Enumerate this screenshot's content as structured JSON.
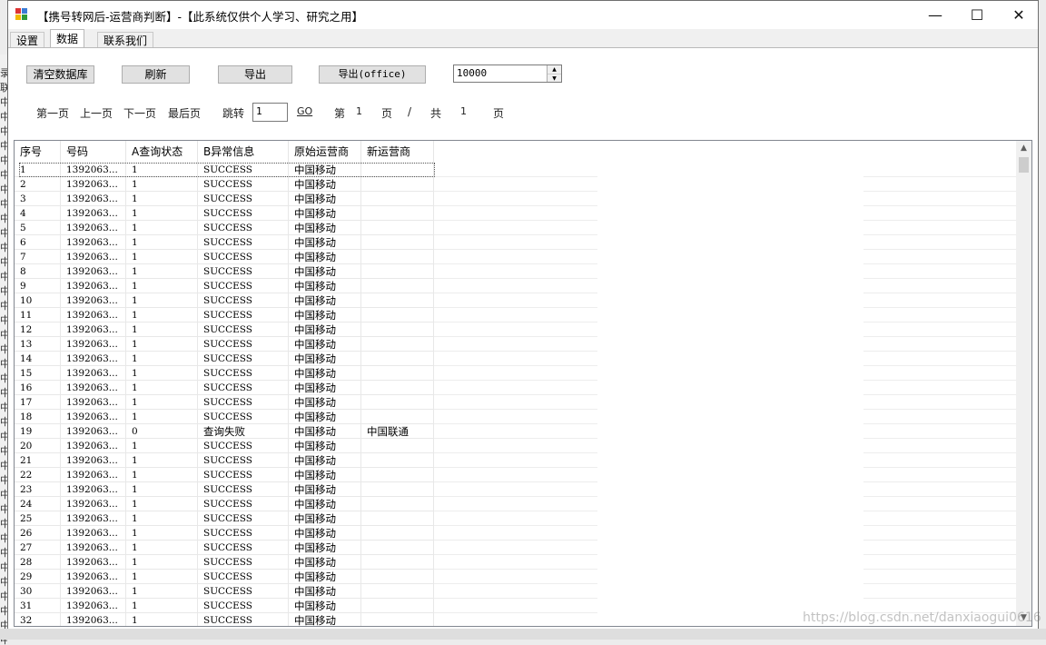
{
  "window": {
    "title": "【携号转网后-运营商判断】-【此系统仅供个人学习、研究之用】",
    "minimize": "—",
    "maximize": "☐",
    "close": "✕"
  },
  "tabs": [
    "设置",
    "数据",
    "联系我们"
  ],
  "toolbar": {
    "clear_db": "清空数据库",
    "refresh": "刷新",
    "export": "导出",
    "export_office": "导出(office)",
    "page_size": "10000"
  },
  "pager": {
    "first": "第一页",
    "prev": "上一页",
    "next": "下一页",
    "last": "最后页",
    "jump": "跳转",
    "jump_value": "1",
    "go": "GO",
    "page_prefix": "第",
    "current_page": "1",
    "page_suffix": "页",
    "slash": "/",
    "total_prefix": "共",
    "total_pages": "1",
    "total_suffix": "页"
  },
  "table": {
    "columns": [
      "序号",
      "号码",
      "A查询状态",
      "B异常信息",
      "原始运营商",
      "新运营商"
    ],
    "rows": [
      [
        "1",
        "1392063...",
        "1",
        "SUCCESS",
        "中国移动",
        ""
      ],
      [
        "2",
        "1392063...",
        "1",
        "SUCCESS",
        "中国移动",
        ""
      ],
      [
        "3",
        "1392063...",
        "1",
        "SUCCESS",
        "中国移动",
        ""
      ],
      [
        "4",
        "1392063...",
        "1",
        "SUCCESS",
        "中国移动",
        ""
      ],
      [
        "5",
        "1392063...",
        "1",
        "SUCCESS",
        "中国移动",
        ""
      ],
      [
        "6",
        "1392063...",
        "1",
        "SUCCESS",
        "中国移动",
        ""
      ],
      [
        "7",
        "1392063...",
        "1",
        "SUCCESS",
        "中国移动",
        ""
      ],
      [
        "8",
        "1392063...",
        "1",
        "SUCCESS",
        "中国移动",
        ""
      ],
      [
        "9",
        "1392063...",
        "1",
        "SUCCESS",
        "中国移动",
        ""
      ],
      [
        "10",
        "1392063...",
        "1",
        "SUCCESS",
        "中国移动",
        ""
      ],
      [
        "11",
        "1392063...",
        "1",
        "SUCCESS",
        "中国移动",
        ""
      ],
      [
        "12",
        "1392063...",
        "1",
        "SUCCESS",
        "中国移动",
        ""
      ],
      [
        "13",
        "1392063...",
        "1",
        "SUCCESS",
        "中国移动",
        ""
      ],
      [
        "14",
        "1392063...",
        "1",
        "SUCCESS",
        "中国移动",
        ""
      ],
      [
        "15",
        "1392063...",
        "1",
        "SUCCESS",
        "中国移动",
        ""
      ],
      [
        "16",
        "1392063...",
        "1",
        "SUCCESS",
        "中国移动",
        ""
      ],
      [
        "17",
        "1392063...",
        "1",
        "SUCCESS",
        "中国移动",
        ""
      ],
      [
        "18",
        "1392063...",
        "1",
        "SUCCESS",
        "中国移动",
        ""
      ],
      [
        "19",
        "1392063...",
        "0",
        "查询失败",
        "中国移动",
        "中国联通"
      ],
      [
        "20",
        "1392063...",
        "1",
        "SUCCESS",
        "中国移动",
        ""
      ],
      [
        "21",
        "1392063...",
        "1",
        "SUCCESS",
        "中国移动",
        ""
      ],
      [
        "22",
        "1392063...",
        "1",
        "SUCCESS",
        "中国移动",
        ""
      ],
      [
        "23",
        "1392063...",
        "1",
        "SUCCESS",
        "中国移动",
        ""
      ],
      [
        "24",
        "1392063...",
        "1",
        "SUCCESS",
        "中国移动",
        ""
      ],
      [
        "25",
        "1392063...",
        "1",
        "SUCCESS",
        "中国移动",
        ""
      ],
      [
        "26",
        "1392063...",
        "1",
        "SUCCESS",
        "中国移动",
        ""
      ],
      [
        "27",
        "1392063...",
        "1",
        "SUCCESS",
        "中国移动",
        ""
      ],
      [
        "28",
        "1392063...",
        "1",
        "SUCCESS",
        "中国移动",
        ""
      ],
      [
        "29",
        "1392063...",
        "1",
        "SUCCESS",
        "中国移动",
        ""
      ],
      [
        "30",
        "1392063...",
        "1",
        "SUCCESS",
        "中国移动",
        ""
      ],
      [
        "31",
        "1392063...",
        "1",
        "SUCCESS",
        "中国移动",
        ""
      ],
      [
        "32",
        "1392063...",
        "1",
        "SUCCESS",
        "中国移动",
        ""
      ]
    ]
  },
  "background_window": {
    "left_chars": [
      "录",
      "联",
      "中",
      "中",
      "中",
      "中",
      "中",
      "中",
      "中",
      "中",
      "中",
      "中",
      "中",
      "中",
      "中",
      "中",
      "中",
      "中",
      "中",
      "中",
      "中",
      "中",
      "中",
      "中",
      "中",
      "中",
      "中",
      "中",
      "中",
      "中",
      "中",
      "中",
      "中",
      "中",
      "中",
      "中",
      "中",
      "中",
      "中",
      "中"
    ]
  },
  "watermark": "https://blog.csdn.net/danxiaogui0616"
}
